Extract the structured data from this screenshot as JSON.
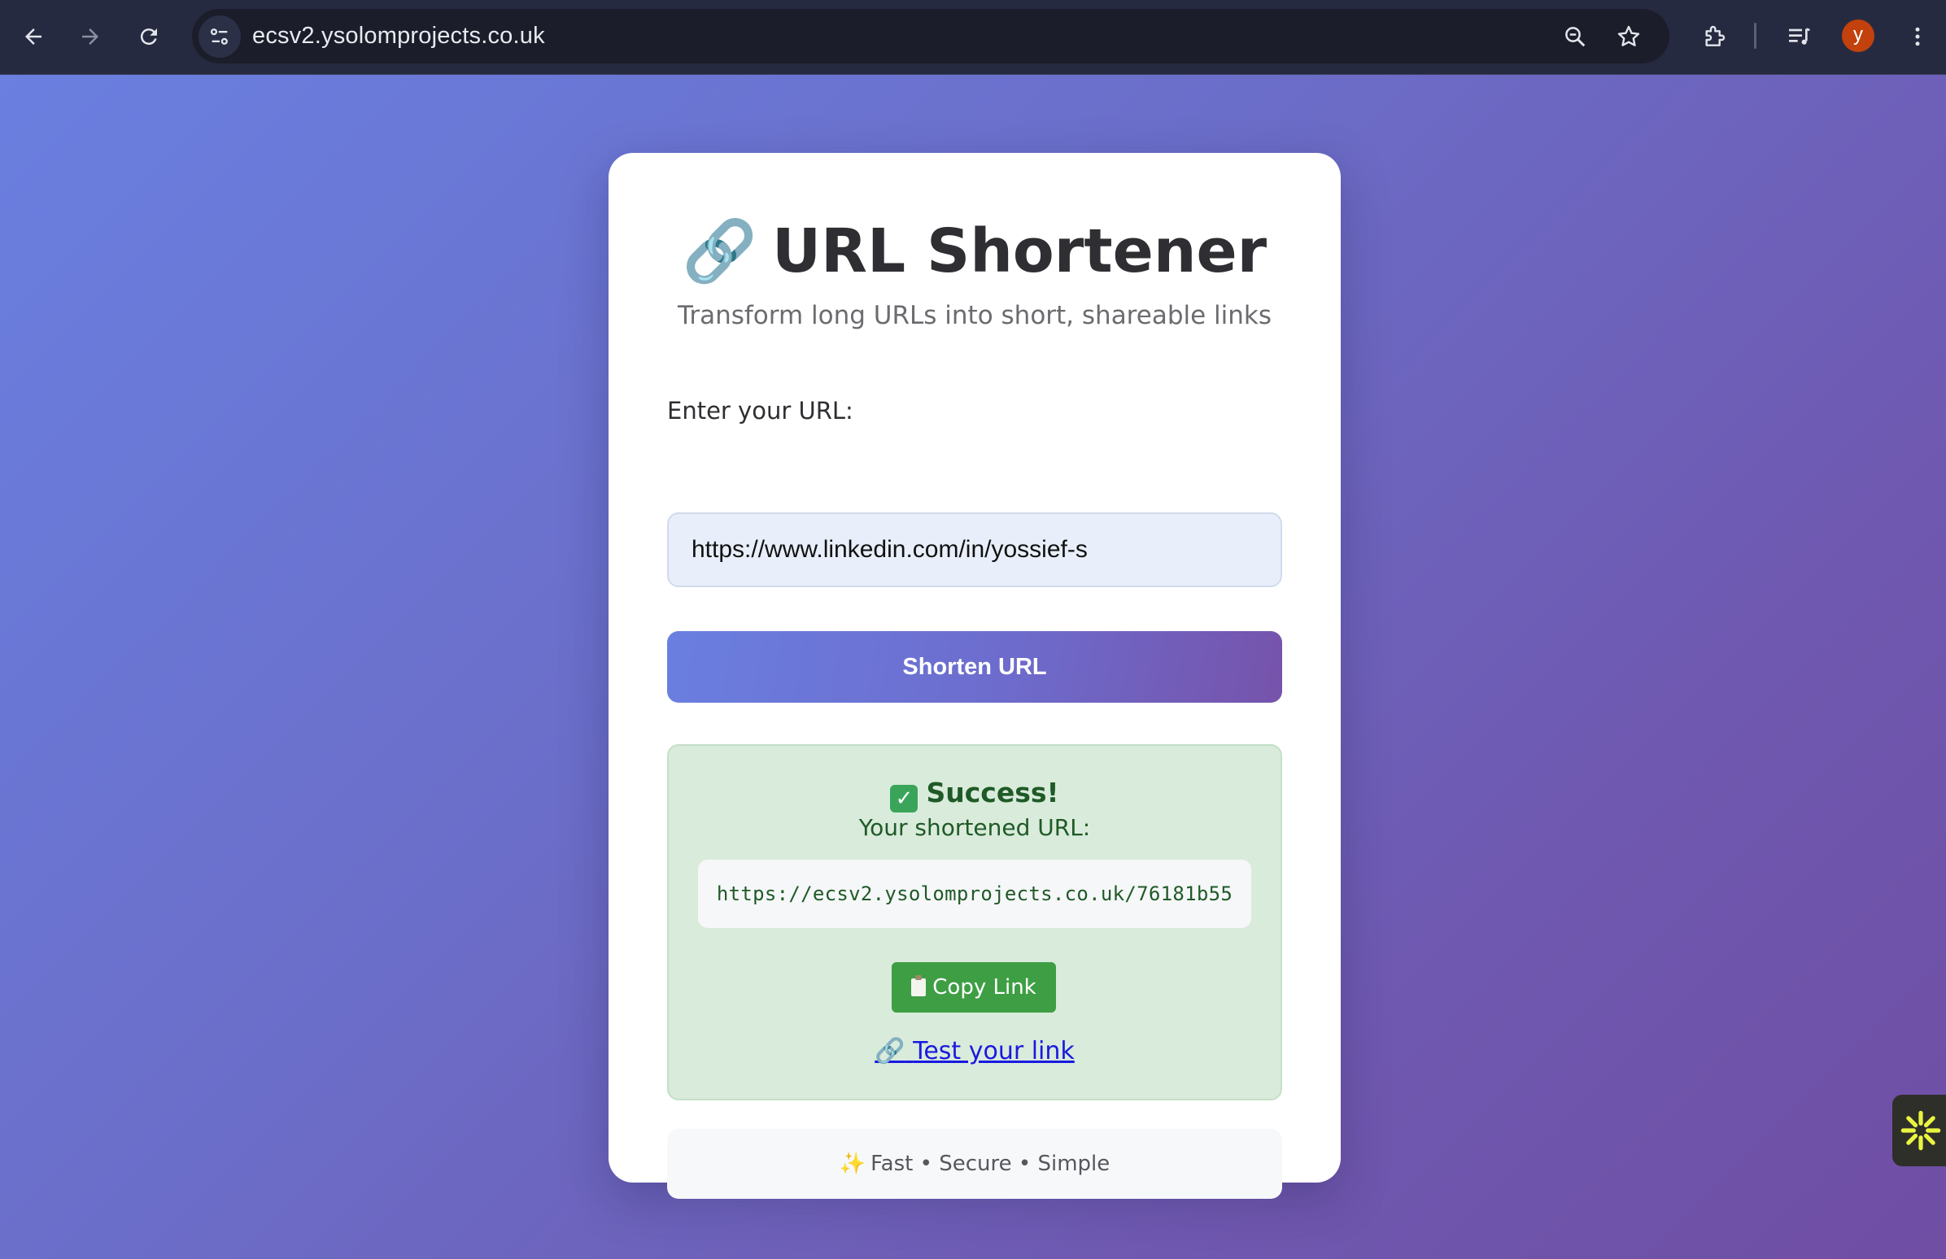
{
  "browser": {
    "url": "ecsv2.ysolomprojects.co.uk",
    "avatar_letter": "y",
    "icons": [
      "back-arrow-icon",
      "forward-arrow-icon",
      "reload-icon",
      "site-info-icon",
      "zoom-icon",
      "bookmark-star-icon",
      "extensions-icon",
      "media-queue-icon",
      "more-menu-icon"
    ]
  },
  "app": {
    "title_emoji": "🔗",
    "title": "URL Shortener",
    "subtitle": "Transform long URLs into short, shareable links",
    "input_label": "Enter your URL:",
    "input_value": "https://www.linkedin.com/in/yossief-s",
    "shorten_button": "Shorten URL",
    "result": {
      "check": "✓",
      "heading": "Success!",
      "subheading": "Your shortened URL:",
      "short_url": "https://ecsv2.ysolomprojects.co.uk/76181b55",
      "copy_button": "Copy Link",
      "test_link_emoji": "🔗",
      "test_link": "Test your link"
    },
    "footer": {
      "sparkle": "✨",
      "text": "Fast • Secure • Simple"
    }
  },
  "colors": {
    "gradient_start": "#6a7fe0",
    "gradient_end": "#7653ab",
    "success_bg": "#d9ebdb",
    "success_text": "#1f5a27",
    "copy_button": "#3e9e44",
    "link": "#1a1adf"
  }
}
